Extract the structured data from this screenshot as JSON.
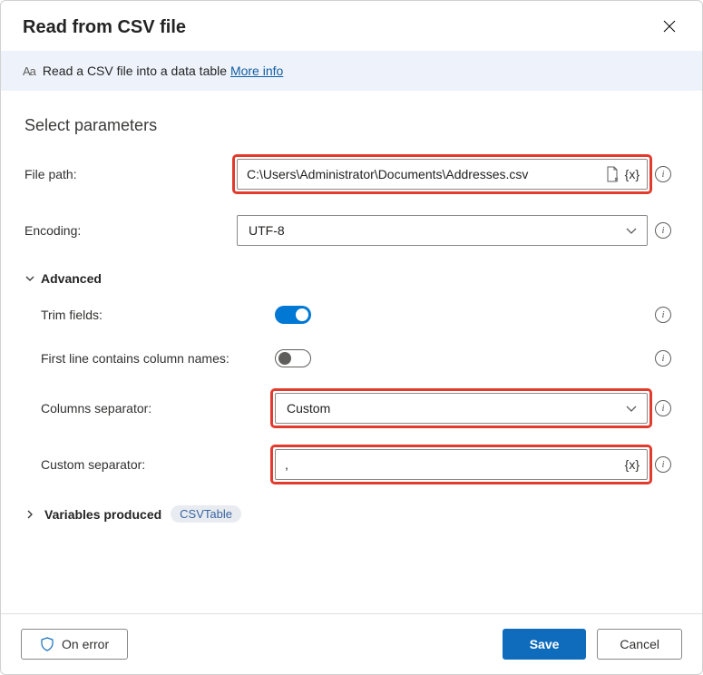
{
  "dialog": {
    "title": "Read from CSV file",
    "info_prefix": "Read a CSV file into a data table ",
    "info_link": "More info"
  },
  "section": {
    "title": "Select parameters"
  },
  "filepath": {
    "label": "File path:",
    "value": "C:\\Users\\Administrator\\Documents\\Addresses.csv",
    "var_token": "{x}"
  },
  "encoding": {
    "label": "Encoding:",
    "value": "UTF-8"
  },
  "advanced": {
    "header": "Advanced",
    "trim": {
      "label": "Trim fields:",
      "on": true
    },
    "firstline": {
      "label": "First line contains column names:",
      "on": false
    },
    "separator": {
      "label": "Columns separator:",
      "value": "Custom"
    },
    "custom_sep": {
      "label": "Custom separator:",
      "value": ",",
      "var_token": "{x}"
    }
  },
  "variables": {
    "label": "Variables produced",
    "badge": "CSVTable"
  },
  "footer": {
    "on_error": "On error",
    "save": "Save",
    "cancel": "Cancel"
  }
}
